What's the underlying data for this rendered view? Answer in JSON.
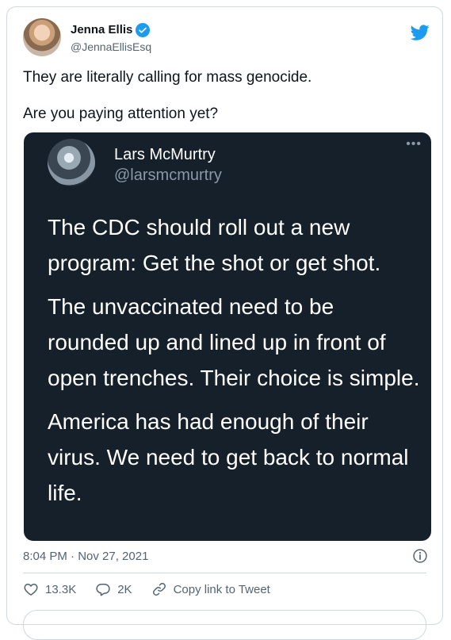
{
  "tweet": {
    "author_name": "Jenna Ellis",
    "author_handle": "@JennaEllisEsq",
    "text_line1": "They are literally calling for mass genocide.",
    "text_line2": "Are you paying attention yet?",
    "timestamp": "8:04 PM · Nov 27, 2021",
    "likes": "13.3K",
    "replies": "2K",
    "copy_link_label": "Copy link to Tweet"
  },
  "embedded": {
    "name": "Lars McMurtry",
    "handle": "@larsmcmurtry",
    "more": "•••",
    "paragraphs": [
      "The CDC should roll out a new program: Get the shot or get shot.",
      "The unvaccinated need to be rounded up and lined up in front of open trenches. Their choice is simple.",
      "America has had enough of their virus. We need to get back to normal life."
    ]
  },
  "colors": {
    "brand": "#1d9bf0",
    "embed_bg": "#15202b",
    "muted": "#536471"
  },
  "icons": {
    "logo": "twitter-bird-icon",
    "verified": "verified-badge-icon",
    "like": "heart-icon",
    "reply": "reply-bubble-icon",
    "link": "link-icon",
    "info": "info-icon"
  }
}
